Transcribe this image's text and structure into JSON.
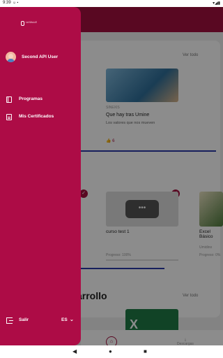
{
  "status_bar": {
    "time": "9:39"
  },
  "background": {
    "see_all_1": "Ver todo",
    "see_all_2": "Ver todo",
    "card1": {
      "category": "SINEXIS",
      "title": "Que hay tras Umine",
      "description": "Los valores que nos mueven",
      "likes": "6"
    },
    "card2": {
      "title": "curso test 1",
      "progress": "Progreso: 100%"
    },
    "card3": {
      "title": "Excel Básico",
      "subtitle": "Umidino",
      "progress": "Progreso: 0%"
    },
    "section_title": "arrollo",
    "bottom_nav": {
      "downloads_label": "Descargas"
    }
  },
  "drawer": {
    "logo_text": "LA SALLE",
    "user_name": "Second API User",
    "menu": [
      {
        "label": "Programas",
        "icon": "book-icon"
      },
      {
        "label": "Mis Certificados",
        "icon": "certificate-icon"
      }
    ],
    "logout_label": "Salir",
    "language": "ES"
  },
  "colors": {
    "brand": "#ad0c46",
    "accent_blue": "#2b3aa8"
  }
}
